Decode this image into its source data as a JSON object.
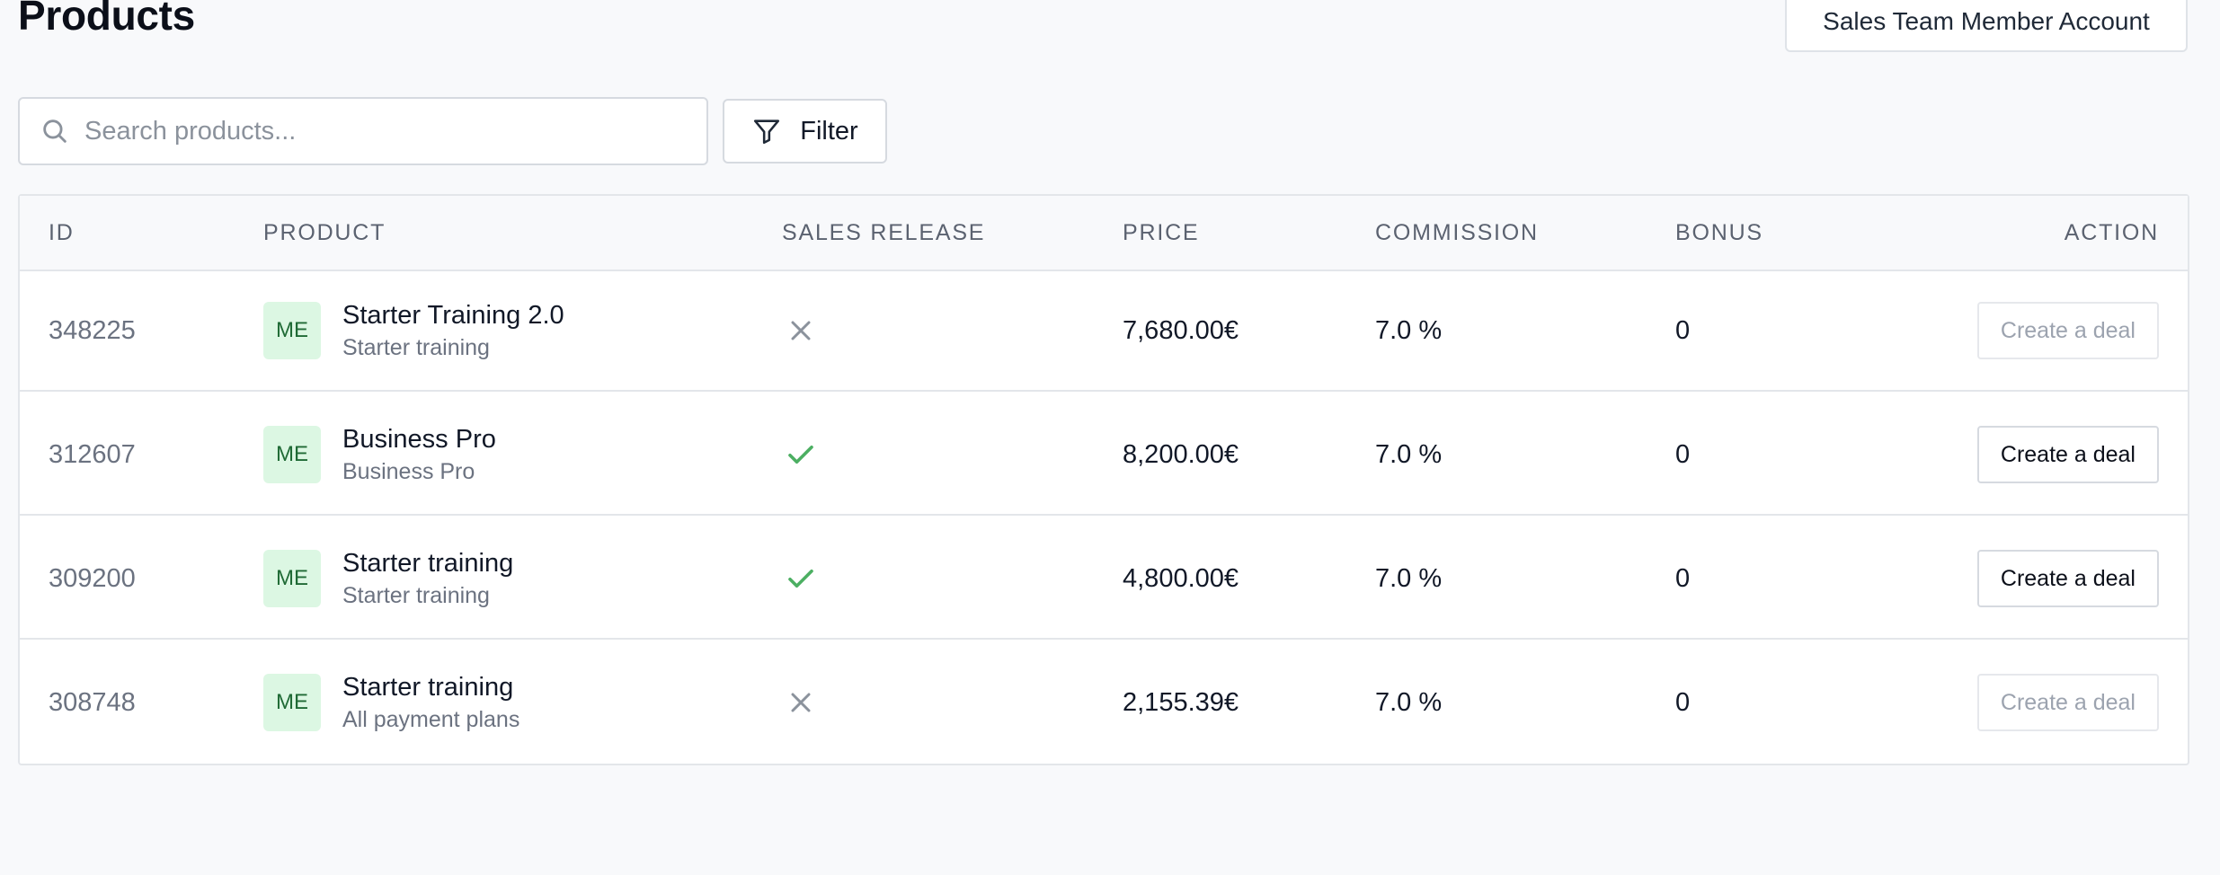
{
  "page": {
    "title": "Products",
    "account_label": "Sales Team Member Account"
  },
  "toolbar": {
    "search_placeholder": "Search products...",
    "search_value": "",
    "filter_label": "Filter"
  },
  "table": {
    "columns": {
      "id": "ID",
      "product": "PRODUCT",
      "sales_release": "SALES RELEASE",
      "price": "PRICE",
      "commission": "COMMISSION",
      "bonus": "BONUS",
      "action": "ACTION"
    },
    "rows": [
      {
        "id": "348225",
        "avatar": "ME",
        "name": "Starter Training 2.0",
        "subtitle": "Starter training",
        "sales_release": false,
        "price": "7,680.00€",
        "commission": "7.0 %",
        "bonus": "0",
        "action": "Create a deal",
        "action_enabled": false
      },
      {
        "id": "312607",
        "avatar": "ME",
        "name": "Business Pro",
        "subtitle": "Business Pro",
        "sales_release": true,
        "price": "8,200.00€",
        "commission": "7.0 %",
        "bonus": "0",
        "action": "Create a deal",
        "action_enabled": true
      },
      {
        "id": "309200",
        "avatar": "ME",
        "name": "Starter training",
        "subtitle": "Starter training",
        "sales_release": true,
        "price": "4,800.00€",
        "commission": "7.0 %",
        "bonus": "0",
        "action": "Create a deal",
        "action_enabled": true
      },
      {
        "id": "308748",
        "avatar": "ME",
        "name": "Starter training",
        "subtitle": "All payment plans",
        "sales_release": false,
        "price": "2,155.39€",
        "commission": "7.0 %",
        "bonus": "0",
        "action": "Create a deal",
        "action_enabled": false
      }
    ]
  },
  "icons": {
    "search": "search-icon",
    "filter": "filter-icon",
    "released": "check-icon",
    "not_released": "x-icon"
  },
  "colors": {
    "check": "#4caf62",
    "cross": "#8b929c",
    "avatar_bg": "#dcf7e3",
    "avatar_text": "#1f6a35"
  }
}
